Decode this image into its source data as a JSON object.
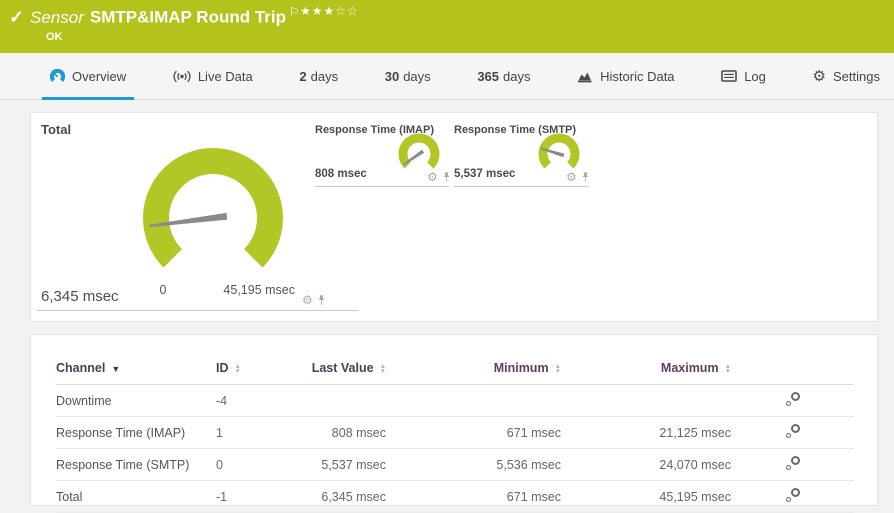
{
  "colors": {
    "brand_green": "#b4c21c",
    "gauge_green": "#b2c626",
    "accent_blue": "#1c9ad6",
    "header_purple": "#5a3f63"
  },
  "header": {
    "kind_label": "Sensor",
    "title": "SMTP&IMAP Round Trip",
    "status": "OK",
    "rating_filled": 3,
    "rating_total": 5
  },
  "tabs": {
    "overview": "Overview",
    "live_data": "Live Data",
    "d2_num": "2",
    "d2_label": "days",
    "d30_num": "30",
    "d30_label": "days",
    "d365_num": "365",
    "d365_label": "days",
    "historic": "Historic Data",
    "log": "Log",
    "settings": "Settings"
  },
  "gauges": {
    "total": {
      "label": "Total",
      "value_text": "6,345 msec",
      "min_label": "0",
      "max_label": "45,195 msec",
      "value": 6345,
      "min": 0,
      "max": 45195
    },
    "imap": {
      "label": "Response Time (IMAP)",
      "value_text": "808 msec",
      "value": 808,
      "min": 0,
      "max": 21125
    },
    "smtp": {
      "label": "Response Time (SMTP)",
      "value_text": "5,537 msec",
      "value": 5537,
      "min": 0,
      "max": 24070
    }
  },
  "table": {
    "headers": {
      "channel": "Channel",
      "id": "ID",
      "last": "Last Value",
      "min": "Minimum",
      "max": "Maximum"
    },
    "rows": [
      {
        "channel": "Downtime",
        "id": "-4",
        "last": "",
        "min": "",
        "max": ""
      },
      {
        "channel": "Response Time (IMAP)",
        "id": "1",
        "last": "808 msec",
        "min": "671 msec",
        "max": "21,125 msec"
      },
      {
        "channel": "Response Time (SMTP)",
        "id": "0",
        "last": "5,537 msec",
        "min": "5,536 msec",
        "max": "24,070 msec"
      },
      {
        "channel": "Total",
        "id": "-1",
        "last": "6,345 msec",
        "min": "671 msec",
        "max": "45,195 msec"
      }
    ]
  }
}
